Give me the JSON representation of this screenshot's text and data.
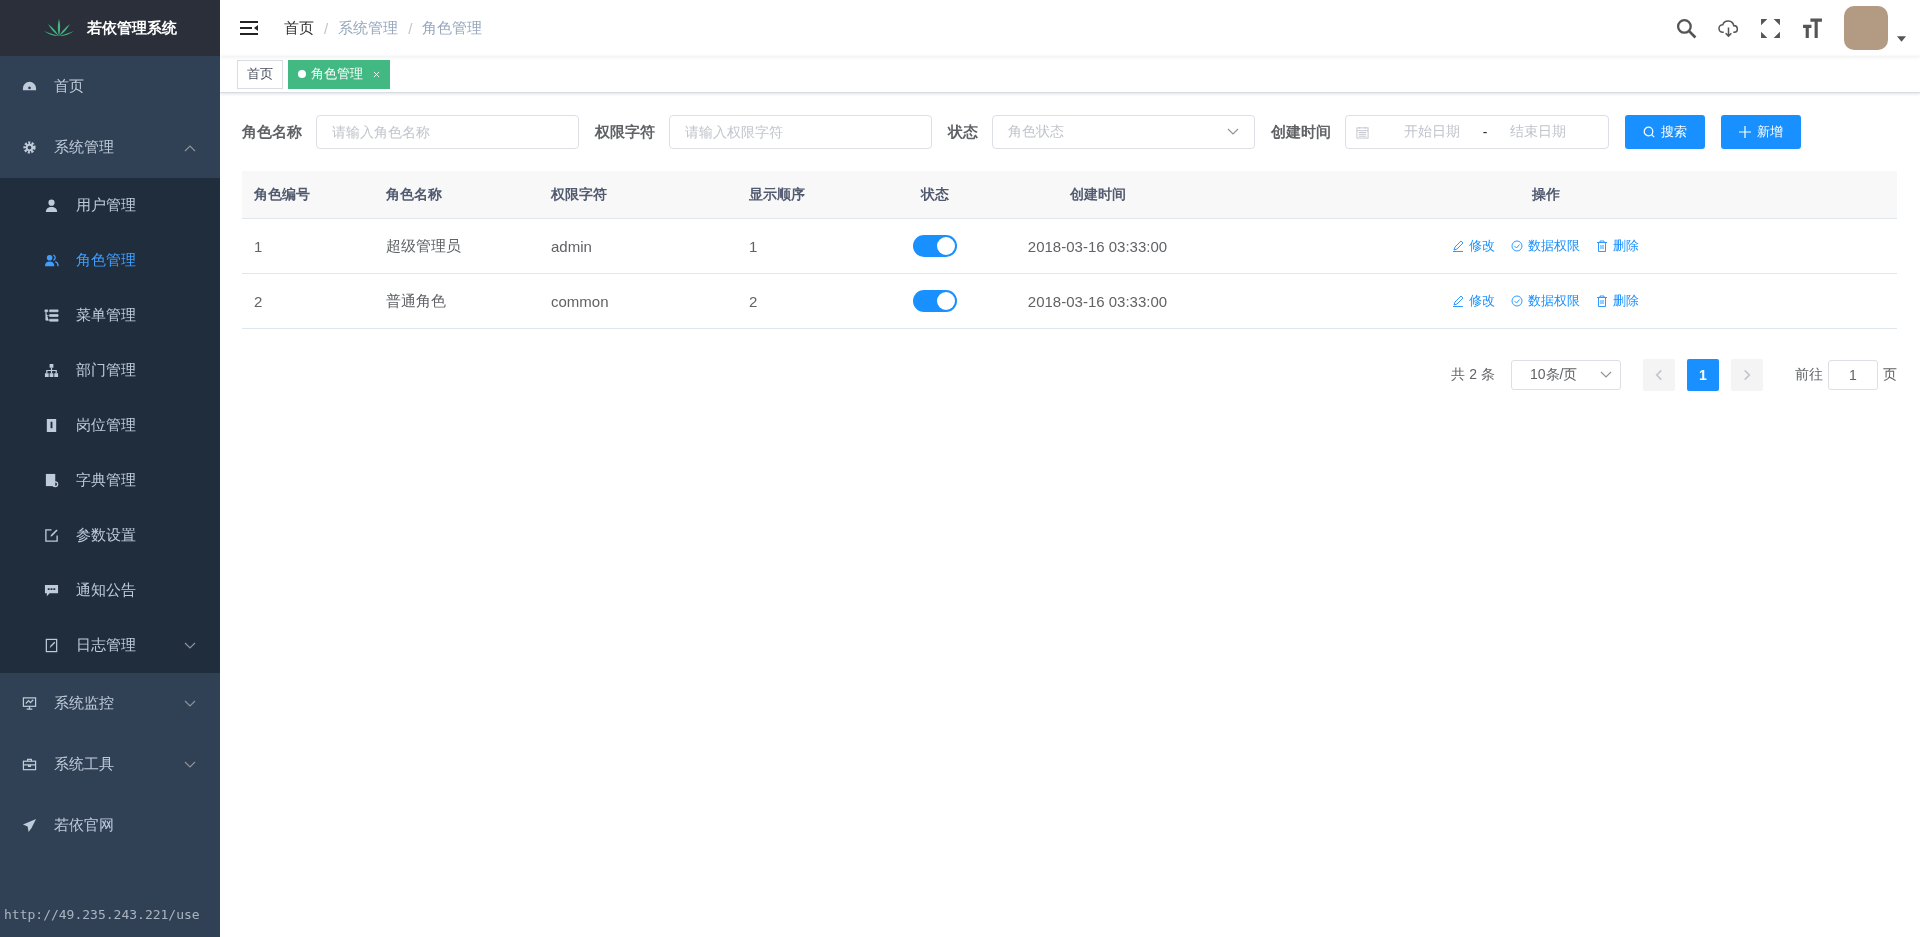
{
  "sidebar": {
    "logo_title": "若依管理系统",
    "items": [
      {
        "label": "首页",
        "selected": false
      },
      {
        "label": "系统管理",
        "selected": false,
        "expanded": true,
        "children": [
          {
            "label": "用户管理",
            "selected": false
          },
          {
            "label": "角色管理",
            "selected": true
          },
          {
            "label": "菜单管理",
            "selected": false
          },
          {
            "label": "部门管理",
            "selected": false
          },
          {
            "label": "岗位管理",
            "selected": false
          },
          {
            "label": "字典管理",
            "selected": false
          },
          {
            "label": "参数设置",
            "selected": false
          },
          {
            "label": "通知公告",
            "selected": false
          },
          {
            "label": "日志管理",
            "selected": false,
            "expanded": false
          }
        ]
      },
      {
        "label": "系统监控",
        "selected": false,
        "expanded": false
      },
      {
        "label": "系统工具",
        "selected": false,
        "expanded": false
      },
      {
        "label": "若依官网",
        "selected": false
      }
    ]
  },
  "breadcrumb": {
    "separator": "/",
    "items": [
      "首页",
      "系统管理",
      "角色管理"
    ]
  },
  "tags": [
    {
      "label": "首页",
      "selected": false
    },
    {
      "label": "角色管理",
      "selected": true
    }
  ],
  "filters": [
    {
      "label": "角色名称",
      "kind": "input",
      "placeholder": "请输入角色名称"
    },
    {
      "label": "权限字符",
      "kind": "input",
      "placeholder": "请输入权限字符"
    },
    {
      "label": "状态",
      "kind": "select",
      "placeholder": "角色状态"
    },
    {
      "label": "创建时间",
      "kind": "daterange",
      "start_placeholder": "开始日期",
      "separator": "-",
      "end_placeholder": "结束日期"
    }
  ],
  "buttons": [
    {
      "label": "搜索",
      "kind": "search"
    },
    {
      "label": "新增",
      "kind": "add"
    }
  ],
  "table": {
    "columns": [
      "角色编号",
      "角色名称",
      "权限字符",
      "显示顺序",
      "状态",
      "创建时间",
      "操作"
    ],
    "rows": [
      {
        "id": "1",
        "name": "超级管理员",
        "key": "admin",
        "order": "1",
        "on": true,
        "created": "2018-03-16 03:33:00",
        "actions": [
          "修改",
          "数据权限",
          "删除"
        ]
      },
      {
        "id": "2",
        "name": "普通角色",
        "key": "common",
        "order": "2",
        "on": true,
        "created": "2018-03-16 03:33:00",
        "actions": [
          "修改",
          "数据权限",
          "删除"
        ]
      }
    ]
  },
  "pagination": {
    "total": "共 2 条",
    "page_size": "10条/页",
    "pages": [
      {
        "label": "1",
        "selected": true
      }
    ],
    "goto_label": "前往",
    "goto_value": "1",
    "page_unit": "页"
  },
  "status_url": "http://49.235.243.221/use"
}
